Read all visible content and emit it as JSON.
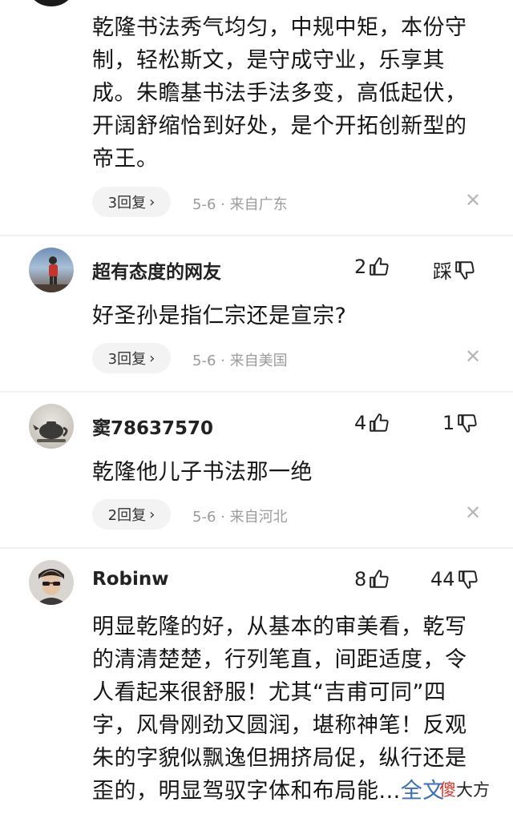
{
  "comments": [
    {
      "text_lines": [
        "乾隆书法秀气均匀，中规中矩，本份守",
        "制，轻松斯文，是守成守业，乐享其",
        "成。朱瞻基书法手法多变，高低起伏，",
        "开阔舒缩恰到好处，是个开拓创新型的",
        "帝王。"
      ],
      "replies": "3回复",
      "meta": "5-6 · 来自广东"
    },
    {
      "username": "超有态度的网友",
      "likes": "2",
      "dislikes": "踩",
      "text_lines": [
        "好圣孙是指仁宗还是宣宗?"
      ],
      "replies": "3回复",
      "meta": "5-6 · 来自美国"
    },
    {
      "username": "窦78637570",
      "likes": "4",
      "dislikes": "1",
      "text_lines": [
        "乾隆他儿子书法那一绝"
      ],
      "replies": "2回复",
      "meta": "5-6 · 来自河北"
    },
    {
      "username": "Robinw",
      "likes": "8",
      "dislikes": "44",
      "text_lines": [
        "明显乾隆的好，从基本的审美看，乾写",
        "的清清楚楚，行列笔直，间距适度，令",
        "人看起来很舒服！尤其“吉甫可同”四",
        "字，风骨刚劲又圆润，堪称神笔！反观",
        "朱的字貌似飘逸但拥挤局促，纵行还是"
      ],
      "last_line": "歪的，明显驾驭字体和布局能...",
      "full_text_link": "全文"
    }
  ],
  "watermark": {
    "red": "傻",
    "rest": "大方"
  },
  "icons": {
    "like": "thumb-up-icon",
    "dislike": "thumb-down-icon",
    "close": "close-icon",
    "chevron": "chevron-right-icon"
  }
}
